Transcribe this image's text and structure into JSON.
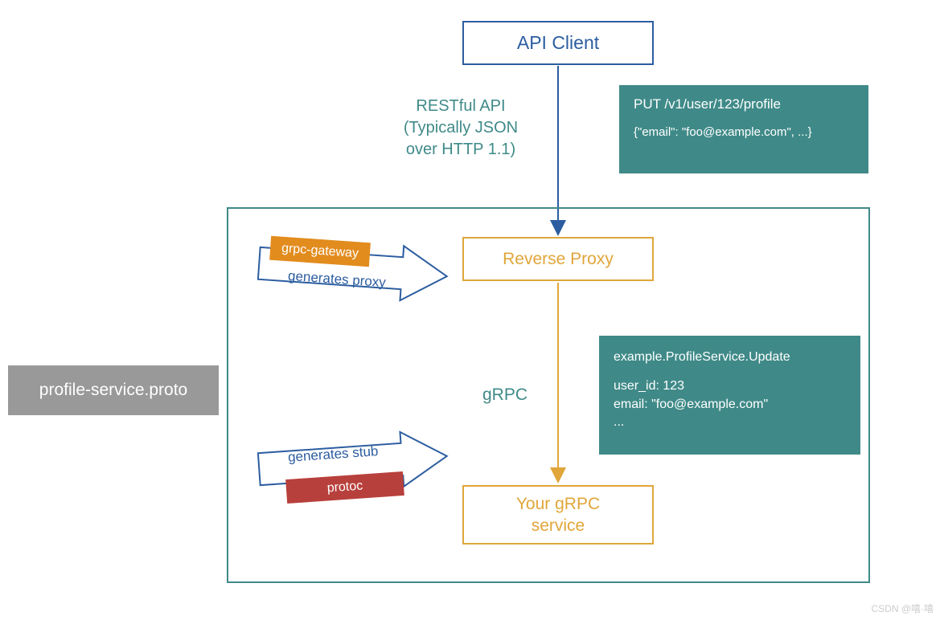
{
  "nodes": {
    "api_client": "API Client",
    "reverse_proxy": "Reverse Proxy",
    "your_service_l1": "Your gRPC",
    "your_service_l2": "service",
    "proto_file": "profile-service.proto"
  },
  "edges": {
    "rest_l1": "RESTful API",
    "rest_l2": "(Typically JSON",
    "rest_l3": "over HTTP 1.1)",
    "grpc": "gRPC"
  },
  "arrows": {
    "grpc_gateway_tag": "grpc-gateway",
    "generates_proxy": "generates proxy",
    "protoc_tag": "protoc",
    "generates_stub": "generates stub"
  },
  "payloads": {
    "rest_line1": "PUT /v1/user/123/profile",
    "rest_line2": "{\"email\": \"foo@example.com\", ...}",
    "grpc_line1": "example.ProfileService.Update",
    "grpc_line2": "user_id: 123",
    "grpc_line3": "email: \"foo@example.com\"",
    "grpc_line4": "..."
  },
  "colors": {
    "blue": "#2c5da0",
    "teal": "#3f8a88",
    "yellow": "#e0a63a",
    "orange": "#e28c1e",
    "red": "#b8403c",
    "gray": "#999999"
  },
  "watermark": "CSDN @嘻·嘻"
}
